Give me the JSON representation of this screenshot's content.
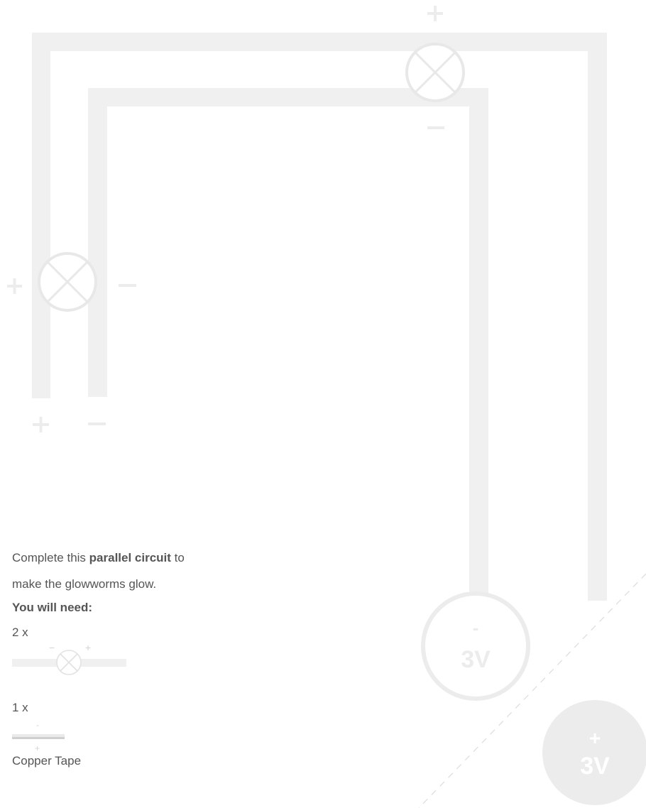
{
  "intro": {
    "line1_before": "Complete this ",
    "line1_bold": "parallel circuit",
    "line1_after": " to",
    "line2": "make the glowworms glow."
  },
  "needs": {
    "heading": "You will need:",
    "bulb_qty": "2 x",
    "bulb_minus": "−",
    "bulb_plus": "+",
    "tape_qty": "1 x",
    "tape_minus": "-",
    "tape_plus": "+",
    "tape_name": "Copper Tape"
  },
  "battery_neg": {
    "sign": "-",
    "voltage": "3V"
  },
  "battery_pos": {
    "sign": "+",
    "voltage": "3V"
  },
  "colors": {
    "track": "#f0f0f1",
    "component_line": "#e8e8e9",
    "battery_fill": "#ececed",
    "text": "#555555"
  }
}
